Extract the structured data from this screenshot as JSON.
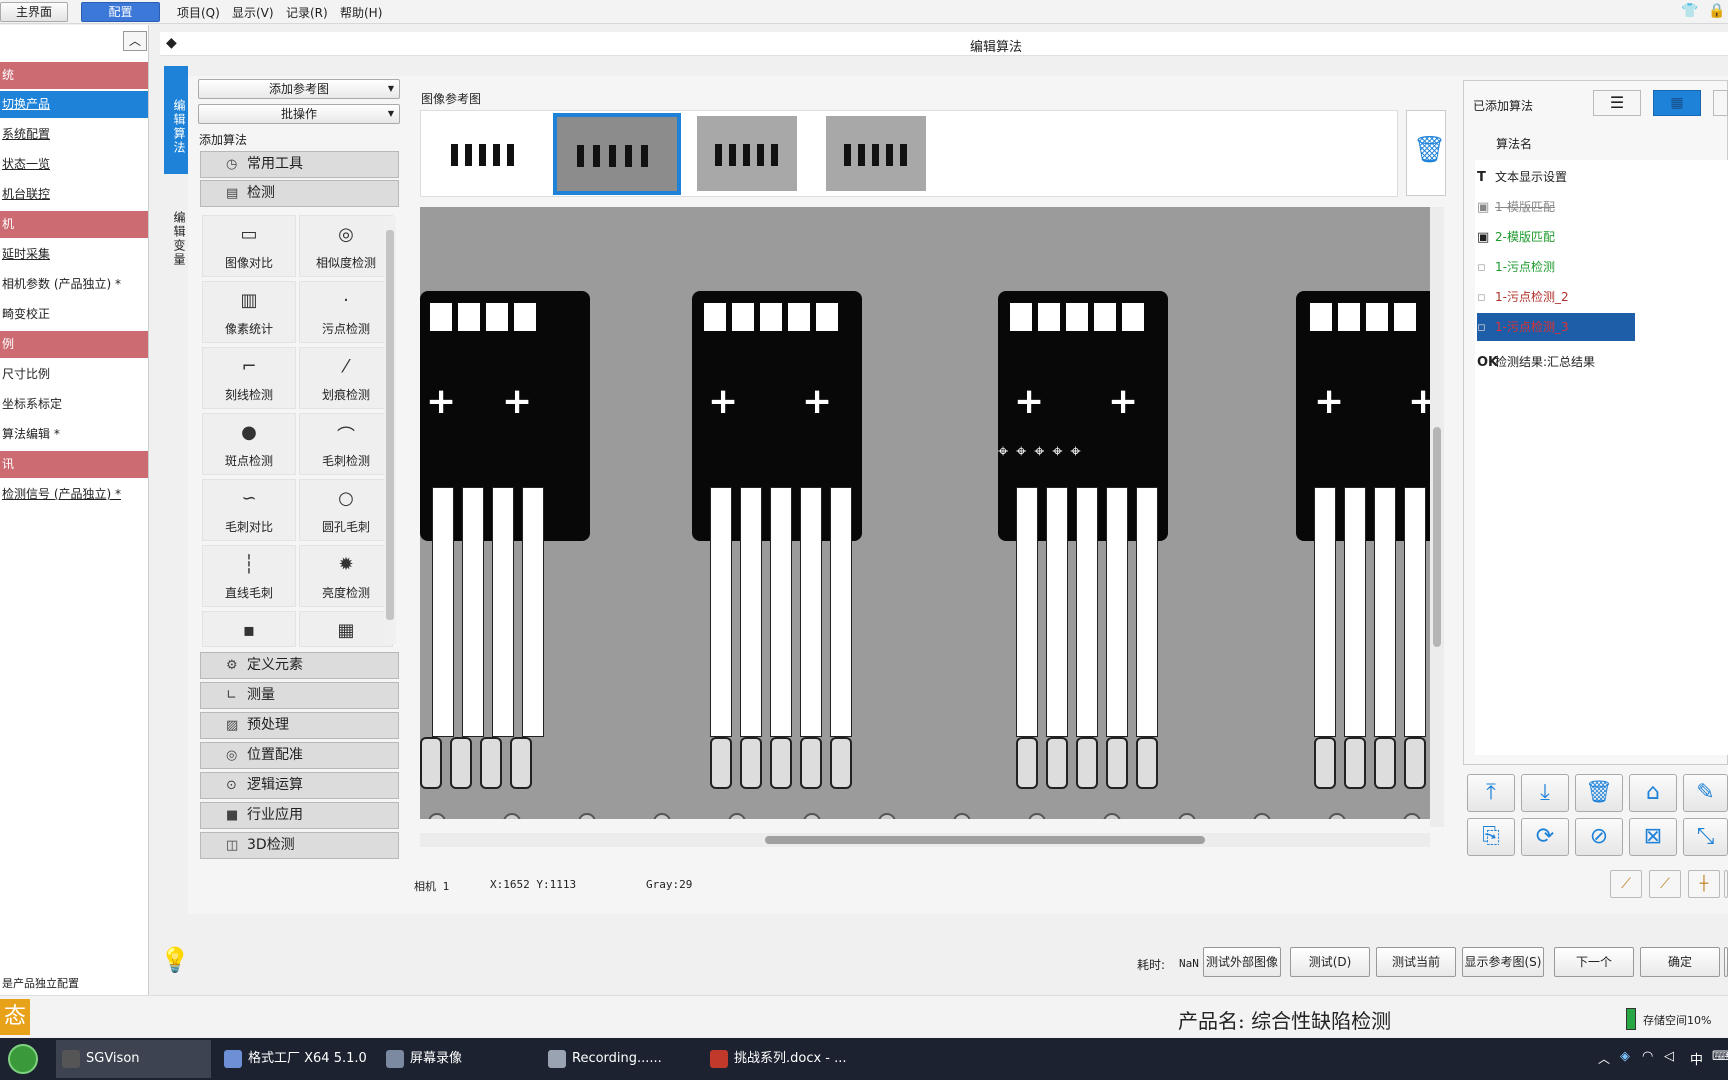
{
  "toolbar": {
    "main_tab": "主界面",
    "config_tab": "配置"
  },
  "menu": {
    "project": "项目(Q)",
    "display": "显示(V)",
    "record": "记录(R)",
    "help": "帮助(H)"
  },
  "sidebar": {
    "items": [
      {
        "label": "统",
        "kind": "head"
      },
      {
        "label": "切换产品",
        "kind": "selected"
      },
      {
        "label": "系统配置",
        "kind": "link"
      },
      {
        "label": "状态一览",
        "kind": "link"
      },
      {
        "label": "机台联控",
        "kind": "link"
      },
      {
        "label": "机",
        "kind": "head"
      },
      {
        "label": "延时采集",
        "kind": "link"
      },
      {
        "label": "相机参数 (产品独立) *",
        "kind": "plain"
      },
      {
        "label": "畸变校正",
        "kind": "plain"
      },
      {
        "label": "例",
        "kind": "head"
      },
      {
        "label": "尺寸比例",
        "kind": "plain"
      },
      {
        "label": "坐标系标定",
        "kind": "plain"
      },
      {
        "label": "算法编辑 *",
        "kind": "plain"
      },
      {
        "label": "讯",
        "kind": "head"
      },
      {
        "label": "检测信号 (产品独立) *",
        "kind": "link"
      }
    ],
    "footer_note": "是产品独立配置"
  },
  "editor": {
    "title": "编辑算法",
    "vtabs": [
      "编辑算法",
      "编辑变量"
    ],
    "add_ref_button": "添加参考图",
    "batch_button": "批操作",
    "add_algo_label": "添加算法",
    "ref_image_label": "图像参考图"
  },
  "categories": [
    {
      "label": "常用工具",
      "icon": "clock-icon"
    },
    {
      "label": "检测",
      "icon": "inspect-icon"
    },
    {
      "label": "定义元素",
      "icon": "gear-icon"
    },
    {
      "label": "测量",
      "icon": "ruler-icon"
    },
    {
      "label": "预处理",
      "icon": "image-icon"
    },
    {
      "label": "位置配准",
      "icon": "target-icon"
    },
    {
      "label": "逻辑运算",
      "icon": "toggle-icon"
    },
    {
      "label": "行业应用",
      "icon": "briefcase-icon"
    },
    {
      "label": "3D检测",
      "icon": "3d-icon"
    }
  ],
  "tools": [
    {
      "label": "图像对比",
      "glyph": "▭"
    },
    {
      "label": "相似度检测",
      "glyph": "◎"
    },
    {
      "label": "像素统计",
      "glyph": "▥"
    },
    {
      "label": "污点检测",
      "glyph": "·"
    },
    {
      "label": "刻线检测",
      "glyph": "⌐"
    },
    {
      "label": "划痕检测",
      "glyph": "⁄"
    },
    {
      "label": "斑点检测",
      "glyph": "●"
    },
    {
      "label": "毛刺检测",
      "glyph": "⌒"
    },
    {
      "label": "毛刺对比",
      "glyph": "∽"
    },
    {
      "label": "圆孔毛刺",
      "glyph": "○"
    },
    {
      "label": "直线毛刺",
      "glyph": "┆"
    },
    {
      "label": "亮度检测",
      "glyph": "✹"
    },
    {
      "label": "",
      "glyph": "▪"
    },
    {
      "label": "",
      "glyph": "▦"
    }
  ],
  "status": {
    "camera": "相机 1",
    "coords": "X:1652 Y:1113",
    "gray": "Gray:29"
  },
  "right": {
    "title": "已添加算法",
    "col_header": "算法名",
    "algorithms": [
      {
        "label": "文本显示设置",
        "icon": "T",
        "color": "#222222",
        "strike": false
      },
      {
        "label": "1-模版匹配",
        "icon": "▣",
        "color": "#888888",
        "strike": true
      },
      {
        "label": "2-模版匹配",
        "icon": "▣",
        "color": "#1c9a2c",
        "strike": false
      },
      {
        "label": "1-污点检测",
        "icon": "▫",
        "color": "#1c9a2c",
        "strike": false
      },
      {
        "label": "1-污点检测_2",
        "icon": "▫",
        "color": "#b1322c",
        "strike": false
      },
      {
        "label": "1-污点检测_3",
        "icon": "▫",
        "color": "#d33333",
        "strike": false
      },
      {
        "label": "检测结果:汇总结果",
        "icon": "OK",
        "color": "#222222",
        "strike": false
      }
    ]
  },
  "bottom": {
    "elapsed_label": "耗时:",
    "elapsed_value": "NaN",
    "buttons": [
      "测试外部图像",
      "测试(D)",
      "测试当前",
      "显示参考图(S)",
      "下一个",
      "确定"
    ],
    "product_name": "产品名: 综合性缺陷检测",
    "storage": "存储空间10%",
    "state_badge": "态"
  },
  "taskbar": {
    "items": [
      {
        "label": "SGVison",
        "color": "#3d4350"
      },
      {
        "label": "格式工厂 X64 5.1.0",
        "color": "#6c8fd6"
      },
      {
        "label": "屏幕录像",
        "color": "#7b8aa0"
      },
      {
        "label": "Recording......",
        "color": "#9aa3b2"
      },
      {
        "label": "挑战系列.docx - ...",
        "color": "#c0392b"
      }
    ],
    "ime": "中"
  },
  "colors": {
    "accent": "#1e82d9",
    "section_head": "#cd6b73",
    "selected_alg": "#1e5ea8"
  }
}
